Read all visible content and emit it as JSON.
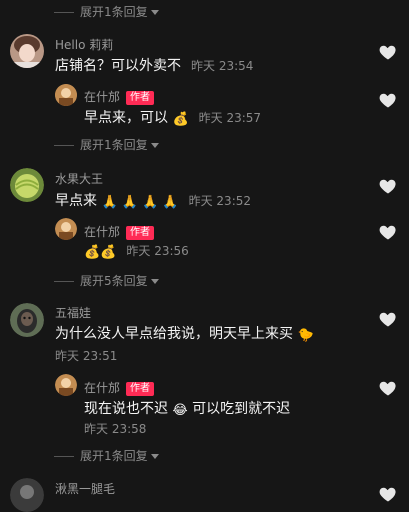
{
  "top_expand": {
    "label": "展开1条回复"
  },
  "comments": [
    {
      "username": "Hello 莉莉",
      "text": "店铺名？可以外卖不",
      "time": "昨天 23:54",
      "reply": {
        "username": "在什邡",
        "badge": "作者",
        "text": "早点来，可以",
        "emoji": "💰",
        "time": "昨天 23:57"
      },
      "expand_label": "展开1条回复"
    },
    {
      "username": "水果大王",
      "text": "早点来",
      "emoji": "🙏 🙏 🙏 🙏",
      "time": "昨天 23:52",
      "reply": {
        "username": "在什邡",
        "badge": "作者",
        "emoji": "💰💰",
        "time": "昨天 23:56"
      },
      "expand_label": "展开5条回复"
    },
    {
      "username": "五福娃",
      "text": "为什么没人早点给我说，明天早上来买",
      "emoji": "🐤",
      "time": "昨天 23:51",
      "reply": {
        "username": "在什邡",
        "badge": "作者",
        "text": "现在说也不迟",
        "emoji": "😂",
        "text2": "可以吃到就不迟",
        "time": "昨天 23:58"
      },
      "expand_label": "展开1条回复"
    },
    {
      "username": "湫黑一腿毛"
    }
  ],
  "colors": {
    "background": "#161616",
    "badge": "#ff2b55",
    "secondary_text": "#8a8a8a"
  },
  "icons": {
    "like": "heart-icon",
    "expand": "caret-down-icon"
  }
}
